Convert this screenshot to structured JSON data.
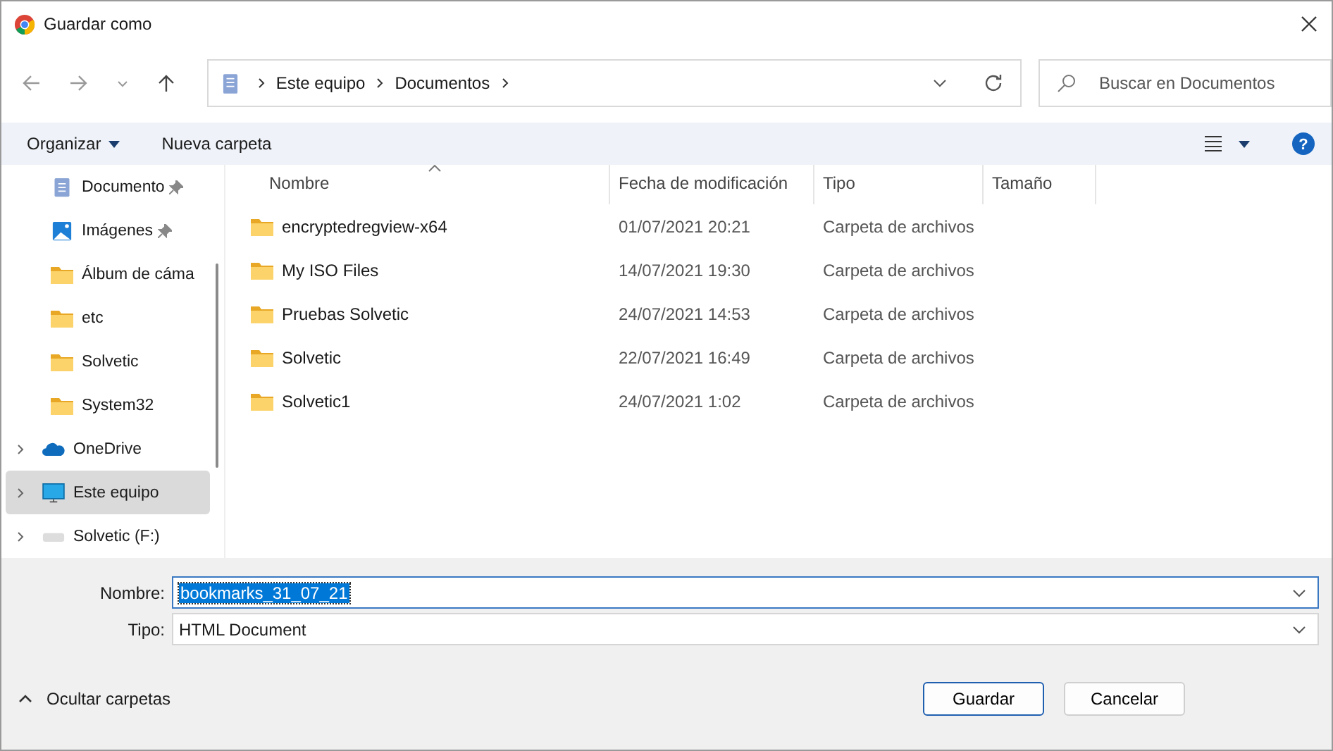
{
  "window": {
    "title": "Guardar como"
  },
  "address": {
    "path": [
      "Este equipo",
      "Documentos"
    ]
  },
  "search": {
    "placeholder": "Buscar en Documentos"
  },
  "toolbar": {
    "organize": "Organizar",
    "new_folder": "Nueva carpeta",
    "help": "?"
  },
  "sidebar": {
    "items": [
      {
        "label": "Documento",
        "kind": "document",
        "pinned": true,
        "expandable": false,
        "selected": false
      },
      {
        "label": "Imágenes",
        "kind": "pictures",
        "pinned": true,
        "expandable": false,
        "selected": false
      },
      {
        "label": "Álbum de cáma",
        "kind": "folder",
        "pinned": false,
        "expandable": false,
        "selected": false
      },
      {
        "label": "etc",
        "kind": "folder",
        "pinned": false,
        "expandable": false,
        "selected": false
      },
      {
        "label": "Solvetic",
        "kind": "folder",
        "pinned": false,
        "expandable": false,
        "selected": false
      },
      {
        "label": "System32",
        "kind": "folder",
        "pinned": false,
        "expandable": false,
        "selected": false
      },
      {
        "label": "OneDrive",
        "kind": "cloud",
        "pinned": false,
        "expandable": true,
        "selected": false
      },
      {
        "label": "Este equipo",
        "kind": "computer",
        "pinned": false,
        "expandable": true,
        "selected": true
      },
      {
        "label": "Solvetic (F:)",
        "kind": "drive",
        "pinned": false,
        "expandable": true,
        "selected": false
      }
    ]
  },
  "table": {
    "columns": [
      "Nombre",
      "Fecha de modificación",
      "Tipo",
      "Tamaño"
    ],
    "rows": [
      {
        "name": "encryptedregview-x64",
        "date": "01/07/2021 20:21",
        "type": "Carpeta de archivos"
      },
      {
        "name": "My ISO Files",
        "date": "14/07/2021 19:30",
        "type": "Carpeta de archivos"
      },
      {
        "name": "Pruebas Solvetic",
        "date": "24/07/2021 14:53",
        "type": "Carpeta de archivos"
      },
      {
        "name": "Solvetic",
        "date": "22/07/2021 16:49",
        "type": "Carpeta de archivos"
      },
      {
        "name": "Solvetic1",
        "date": "24/07/2021 1:02",
        "type": "Carpeta de archivos"
      }
    ]
  },
  "form": {
    "name_label": "Nombre:",
    "name_value": "bookmarks_31_07_21",
    "type_label": "Tipo:",
    "type_value": "HTML Document"
  },
  "footer": {
    "hide_folders": "Ocultar carpetas",
    "buttons": [
      "Guardar",
      "Cancelar"
    ]
  }
}
